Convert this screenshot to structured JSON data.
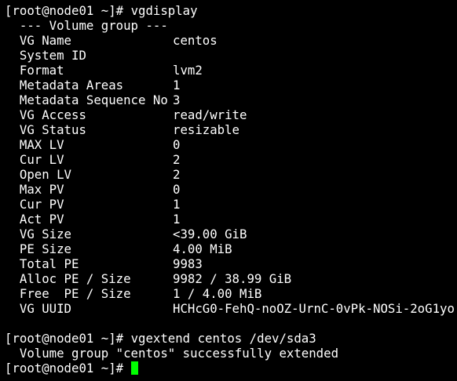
{
  "terminal": {
    "prompt": "[root@node01 ~]# ",
    "command1": "vgdisplay",
    "section_header": "  --- Volume group ---",
    "fields": [
      {
        "key": "  VG Name",
        "value": "centos"
      },
      {
        "key": "  System ID",
        "value": ""
      },
      {
        "key": "  Format",
        "value": "lvm2"
      },
      {
        "key": "  Metadata Areas",
        "value": "1"
      },
      {
        "key": "  Metadata Sequence No",
        "value": "3"
      },
      {
        "key": "  VG Access",
        "value": "read/write"
      },
      {
        "key": "  VG Status",
        "value": "resizable"
      },
      {
        "key": "  MAX LV",
        "value": "0"
      },
      {
        "key": "  Cur LV",
        "value": "2"
      },
      {
        "key": "  Open LV",
        "value": "2"
      },
      {
        "key": "  Max PV",
        "value": "0"
      },
      {
        "key": "  Cur PV",
        "value": "1"
      },
      {
        "key": "  Act PV",
        "value": "1"
      },
      {
        "key": "  VG Size",
        "value": "<39.00 GiB"
      },
      {
        "key": "  PE Size",
        "value": "4.00 MiB"
      },
      {
        "key": "  Total PE",
        "value": "9983"
      },
      {
        "key": "  Alloc PE / Size",
        "value": "9982 / 38.99 GiB"
      },
      {
        "key": "  Free  PE / Size",
        "value": "1 / 4.00 MiB"
      },
      {
        "key": "  VG UUID",
        "value": "HCHcG0-FehQ-noOZ-UrnC-0vPk-NOSi-2oG1yo"
      }
    ],
    "command2": "vgextend centos /dev/sda3",
    "output2": "  Volume group \"centos\" successfully extended",
    "cursor_color": "#00ff00"
  }
}
